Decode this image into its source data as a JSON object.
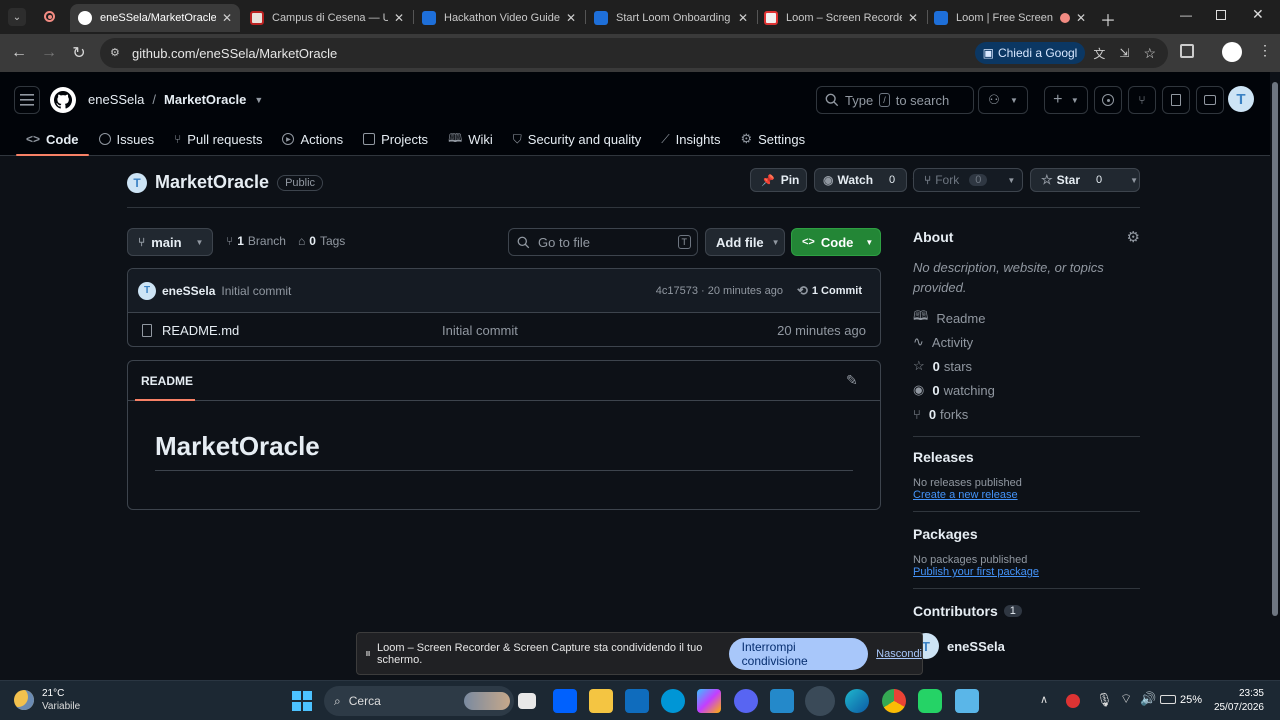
{
  "tabs": [
    {
      "title": "eneSSela/MarketOracle",
      "active": true
    },
    {
      "title": "Campus di Cesena — Uni"
    },
    {
      "title": "Hackathon Video Guide a"
    },
    {
      "title": "Start Loom Onboarding |"
    },
    {
      "title": "Loom – Screen Recorder"
    },
    {
      "title": "Loom | Free Screen &"
    }
  ],
  "address": {
    "url": "github.com/eneSSela/MarketOracle",
    "ask_google": "Chiedi a Googl"
  },
  "github": {
    "owner": "eneSSela",
    "repo": "MarketOracle",
    "search_placeholder_pre": "Type",
    "search_key": "/",
    "search_placeholder_post": "to search",
    "nav": [
      "Code",
      "Issues",
      "Pull requests",
      "Actions",
      "Projects",
      "Wiki",
      "Security and quality",
      "Insights",
      "Settings"
    ]
  },
  "repo": {
    "name": "MarketOracle",
    "visibility": "Public",
    "pin": "Pin",
    "watch": "Watch",
    "watch_count": "0",
    "fork": "Fork",
    "fork_count": "0",
    "star": "Star",
    "star_count": "0"
  },
  "toolbar": {
    "branch": "main",
    "branches_count": "1",
    "branches_label": "Branch",
    "tags_count": "0",
    "tags_label": "Tags",
    "goto_placeholder": "Go to file",
    "goto_key": "T",
    "add_file": "Add file",
    "code": "Code"
  },
  "commit": {
    "author": "eneSSela",
    "message": "Initial commit",
    "hash_time": "4c17573 · 20 minutes ago",
    "commits": "1 Commit"
  },
  "files": [
    {
      "name": "README.md",
      "message": "Initial commit",
      "time": "20 minutes ago"
    }
  ],
  "readme": {
    "tab": "README",
    "heading": "MarketOracle"
  },
  "about": {
    "title": "About",
    "description": "No description, website, or topics provided.",
    "readme": "Readme",
    "activity": "Activity",
    "stars": "0",
    "stars_label": "stars",
    "watching": "0",
    "watching_label": "watching",
    "forks": "0",
    "forks_label": "forks",
    "releases_title": "Releases",
    "releases_empty": "No releases published",
    "releases_link": "Create a new release",
    "packages_title": "Packages",
    "packages_empty": "No packages published",
    "packages_link": "Publish your first package",
    "contributors_title": "Contributors",
    "contributors_count": "1",
    "contributor": "eneSSela"
  },
  "loom": {
    "message": "Loom – Screen Recorder & Screen Capture sta condividendo il tuo schermo.",
    "stop": "Interrompi condivisione",
    "hide": "Nascondi"
  },
  "taskbar": {
    "temp": "21°C",
    "weather": "Variabile",
    "search": "Cerca",
    "battery": "25%",
    "time": "23:35",
    "date": "25/07/2026"
  },
  "colors": {
    "accent": "#f78166",
    "green": "#238636",
    "link": "#4493f8",
    "bg": "#0d1117"
  }
}
